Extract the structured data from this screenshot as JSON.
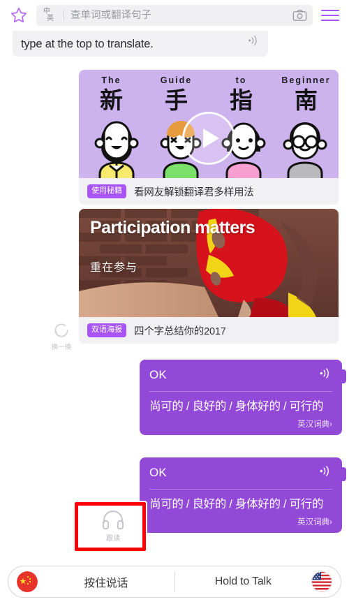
{
  "header": {
    "star_icon": "star-outline-icon",
    "lang_from": "中",
    "lang_to": "英",
    "search_placeholder": "查单词或翻译句子",
    "search_value": "",
    "camera_icon": "camera-icon",
    "menu_icon": "hamburger-menu-icon"
  },
  "feed": {
    "system_message": {
      "text": "type at the top to translate.",
      "speaker_icon": "speaker-icon"
    },
    "cards": [
      {
        "id": "video-card",
        "type": "video",
        "play_icon": "play-icon",
        "headline_en": [
          "The",
          "Guide",
          "to",
          "Beginner"
        ],
        "headline_cn": [
          "新",
          "手",
          "指",
          "南"
        ],
        "badge": "使用秘籍",
        "caption": "看网友解锁翻译君多样用法"
      },
      {
        "id": "poster-card",
        "type": "poster",
        "poster_title": "Participation matters",
        "poster_subtitle": "重在参与",
        "badge": "双语海报",
        "caption": "四个字总结你的2017"
      }
    ],
    "refresh": {
      "icon": "refresh-circle-icon",
      "label": "换一换"
    },
    "messages": [
      {
        "source_text": "OK",
        "speaker_icon": "speaker-icon",
        "translation": "尚可的 / 良好的 / 身体好的 / 可行的",
        "dictionary_link": "英汉词典",
        "chevron": "›"
      },
      {
        "source_text": "OK",
        "speaker_icon": "speaker-icon",
        "translation": "尚可的 / 良好的 / 身体好的 / 可行的",
        "dictionary_link": "英汉词典",
        "chevron": "›"
      }
    ]
  },
  "follow_read_popup": {
    "icon": "headphones-icon",
    "label": "跟读"
  },
  "annotation": {
    "highlight_color": "#fb0007"
  },
  "bottom_bar": {
    "left": {
      "flag": "china-flag-icon",
      "label": "按住说话"
    },
    "right": {
      "label": "Hold to Talk",
      "flag": "usa-flag-icon"
    }
  },
  "colors": {
    "accent_purple": "#a855f7",
    "bubble_purple": "#9249d8",
    "card_art_purple": "#cdb3ee",
    "surface_grey": "#f1f1f4",
    "highlight_red": "#fb0007"
  }
}
